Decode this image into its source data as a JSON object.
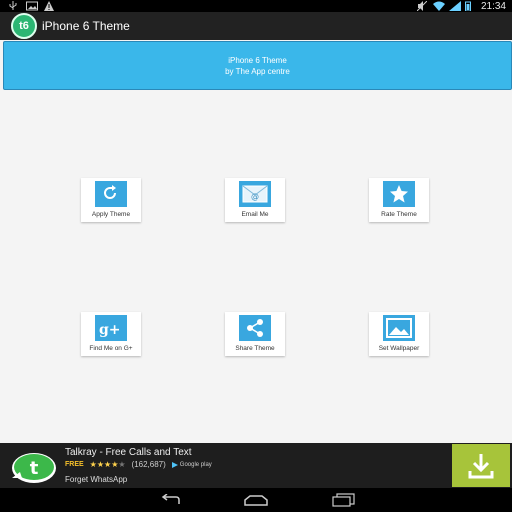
{
  "status": {
    "time": "21:34"
  },
  "appbar": {
    "icon_text": "t6",
    "title": "iPhone 6 Theme"
  },
  "banner": {
    "line1": "iPhone 6 Theme",
    "line2": "by The App centre"
  },
  "tiles": [
    {
      "label": "Apply Theme",
      "icon": "refresh-arrow-icon"
    },
    {
      "label": "Email Me",
      "icon": "email-icon"
    },
    {
      "label": "Rate Theme",
      "icon": "star-icon"
    },
    {
      "label": "Find Me on G+",
      "icon": "google-plus-icon"
    },
    {
      "label": "Share Theme",
      "icon": "share-icon"
    },
    {
      "label": "Set Wallpaper",
      "icon": "wallpaper-icon"
    }
  ],
  "ad": {
    "title": "Talkray - Free Calls and Text",
    "price": "FREE",
    "rating_count": "(162,687)",
    "store": "Google play",
    "subtitle": "Forget WhatsApp",
    "rating": 4
  },
  "colors": {
    "accent": "#3ab7ea",
    "tile_icon": "#39a7df",
    "download": "#a7c43a"
  }
}
